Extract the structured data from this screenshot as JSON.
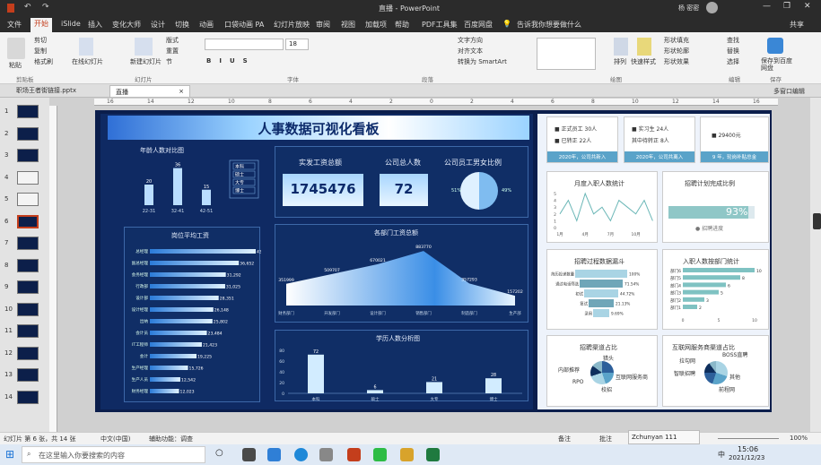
{
  "app": {
    "title_doc": "直播",
    "title_app": "PowerPoint",
    "user": "杨 密密"
  },
  "menu": [
    "文件",
    "开始",
    "iSlide",
    "插入",
    "变化大师",
    "设计",
    "切换",
    "动画",
    "口袋动画 PA",
    "幻灯片放映",
    "审阅",
    "视图",
    "加载项",
    "帮助",
    "PDF工具集",
    "百度网盘",
    "告诉我你想要做什么"
  ],
  "menu_share": "共享",
  "ribbon": {
    "clipboard": [
      "粘贴",
      "剪切",
      "复制",
      "格式刷"
    ],
    "slides": [
      "在线幻灯片",
      "新建幻灯片",
      "版式",
      "重置",
      "节"
    ],
    "drawing": [
      "排列",
      "快速样式"
    ],
    "editing": [
      "查找",
      "替换",
      "选择"
    ],
    "paragraph": [
      "文字方向",
      "对齐文本",
      "转换为 SmartArt"
    ],
    "fill": [
      "形状填充",
      "形状轮廓",
      "形状效果"
    ],
    "font_size": "18",
    "save_baidu": "保存到百度网盘",
    "groups": [
      "剪贴板",
      "幻灯片",
      "字体",
      "段落",
      "绘图",
      "编辑",
      "保存"
    ]
  },
  "doc_tabs": [
    "职场王者街链接.pptx",
    "直播"
  ],
  "doc_tabs_right": "多窗口编辑",
  "thumb_numbers": [
    "1",
    "2",
    "3",
    "4",
    "5",
    "6",
    "7",
    "8",
    "9",
    "10",
    "11",
    "12",
    "13",
    "14"
  ],
  "ruler_top": [
    "16",
    "14",
    "12",
    "10",
    "8",
    "6",
    "4",
    "2",
    "0",
    "2",
    "4",
    "6",
    "8",
    "10",
    "12",
    "14",
    "16"
  ],
  "slide": {
    "title": "人事数据可视化看板",
    "age": {
      "title": "年龄人数对比图",
      "x": [
        "22-31",
        "32-41",
        "42-51"
      ],
      "values": [
        20,
        36,
        15
      ],
      "legend": [
        "本科",
        "硕士",
        "大专",
        "博士"
      ]
    },
    "kpis": [
      {
        "label": "实发工资总额",
        "value": "1745476"
      },
      {
        "label": "公司总人数",
        "value": "72"
      },
      {
        "label": "公司员工男女比例",
        "male": "51%",
        "female": "49%"
      }
    ],
    "salary": {
      "title": "岗位平均工资",
      "categories": [
        "总经理",
        "副总经理",
        "会务经理",
        "行政部",
        "设计部",
        "设计经理",
        "出纳",
        "会计员",
        "IT工程师",
        "会计",
        "生产经理",
        "生产人员",
        "财务经理"
      ],
      "values": [
        43617,
        36652,
        31292,
        31025,
        28351,
        26148,
        25802,
        23484,
        21423,
        19225,
        15726,
        12542,
        12023
      ],
      "labels": [
        "43,617",
        "36,652",
        "31,292",
        "31,025",
        "28,351",
        "26,148",
        "25,802",
        "23,484",
        "21,423",
        "19,225",
        "15,726",
        "12,542",
        "12,023"
      ]
    },
    "dept": {
      "title": "各部门工资总额",
      "x": [
        "财务部门",
        "开发部门",
        "设计部门",
        "销售部门",
        "制造部门",
        "生产部"
      ],
      "values": [
        351999,
        509707,
        670021,
        883770,
        357293,
        157202
      ]
    },
    "edu": {
      "title": "学历人数分析图",
      "x": [
        "本科",
        "硕士",
        "大专",
        "博士"
      ],
      "values": [
        72,
        6,
        21,
        28
      ],
      "yticks": [
        "80",
        "60",
        "40",
        "20",
        "0"
      ]
    },
    "right": {
      "cards": [
        {
          "l1": "正式员工",
          "v1": "30人",
          "l2": "已转正",
          "v2": "22人",
          "foot": "2020年，公司共新入"
        },
        {
          "l1": "实习生",
          "v1": "24人",
          "l2": "其中待转正",
          "v2": "8人",
          "foot": "2020年，公司共离入"
        },
        {
          "v1": "29400元",
          "foot": "9 年，轮岗补贴总金"
        }
      ],
      "monthly": {
        "title": "月度入职人数统计",
        "yticks": [
          "5",
          "4",
          "3",
          "2",
          "1",
          "0"
        ],
        "x": [
          "1月",
          "4月",
          "7月",
          "10月"
        ],
        "values": [
          2,
          4,
          1,
          5,
          2,
          3,
          1,
          4,
          3,
          2,
          4,
          1
        ]
      },
      "plan": {
        "title": "招聘计划完成比例",
        "percent": "93%",
        "value": 0.93,
        "legend": "招聘进度"
      },
      "funnel": {
        "title": "招聘过程数据漏斗",
        "rows": [
          {
            "label": "简历投递数量",
            "pct": "100%"
          },
          {
            "label": "通过电话筛选",
            "pct": "71.54%"
          },
          {
            "label": "初试",
            "pct": "44.72%"
          },
          {
            "label": "复试",
            "pct": "21.13%"
          },
          {
            "label": "录用",
            "pct": "9.69%"
          }
        ]
      },
      "deptbar": {
        "title": "入职人数按部门统计",
        "cats": [
          "部门6",
          "部门5",
          "部门4",
          "部门3",
          "部门2",
          "部门1"
        ],
        "values": [
          10,
          8,
          6,
          5,
          3,
          2
        ],
        "labels": [
          "10",
          "8",
          "6",
          "5",
          "3",
          "2"
        ],
        "xticks": [
          "0",
          "5",
          "10"
        ]
      },
      "channel": {
        "title": "招聘渠道占比",
        "labels": [
          "内部推荐",
          "猎头",
          "互联网服务商",
          "RPO",
          "校招"
        ]
      },
      "web": {
        "title": "互联网服务商渠道占比",
        "labels": [
          "拉勾网",
          "BOSS直聘",
          "智联招聘",
          "其他",
          "前程网"
        ]
      }
    }
  },
  "status": {
    "left": "幻灯片 第 6 张，共 14 张",
    "lang": "中文(中国)",
    "access": "辅助功能：调查",
    "notes": "备注",
    "comments": "批注",
    "zoom": "100%"
  },
  "taskbar": {
    "search": "在这里输入你要搜索的内容",
    "time": "15:06",
    "date": "2021/12/23",
    "ime": "中",
    "popup_user": "Zchunyan",
    "popup_num": "111"
  }
}
